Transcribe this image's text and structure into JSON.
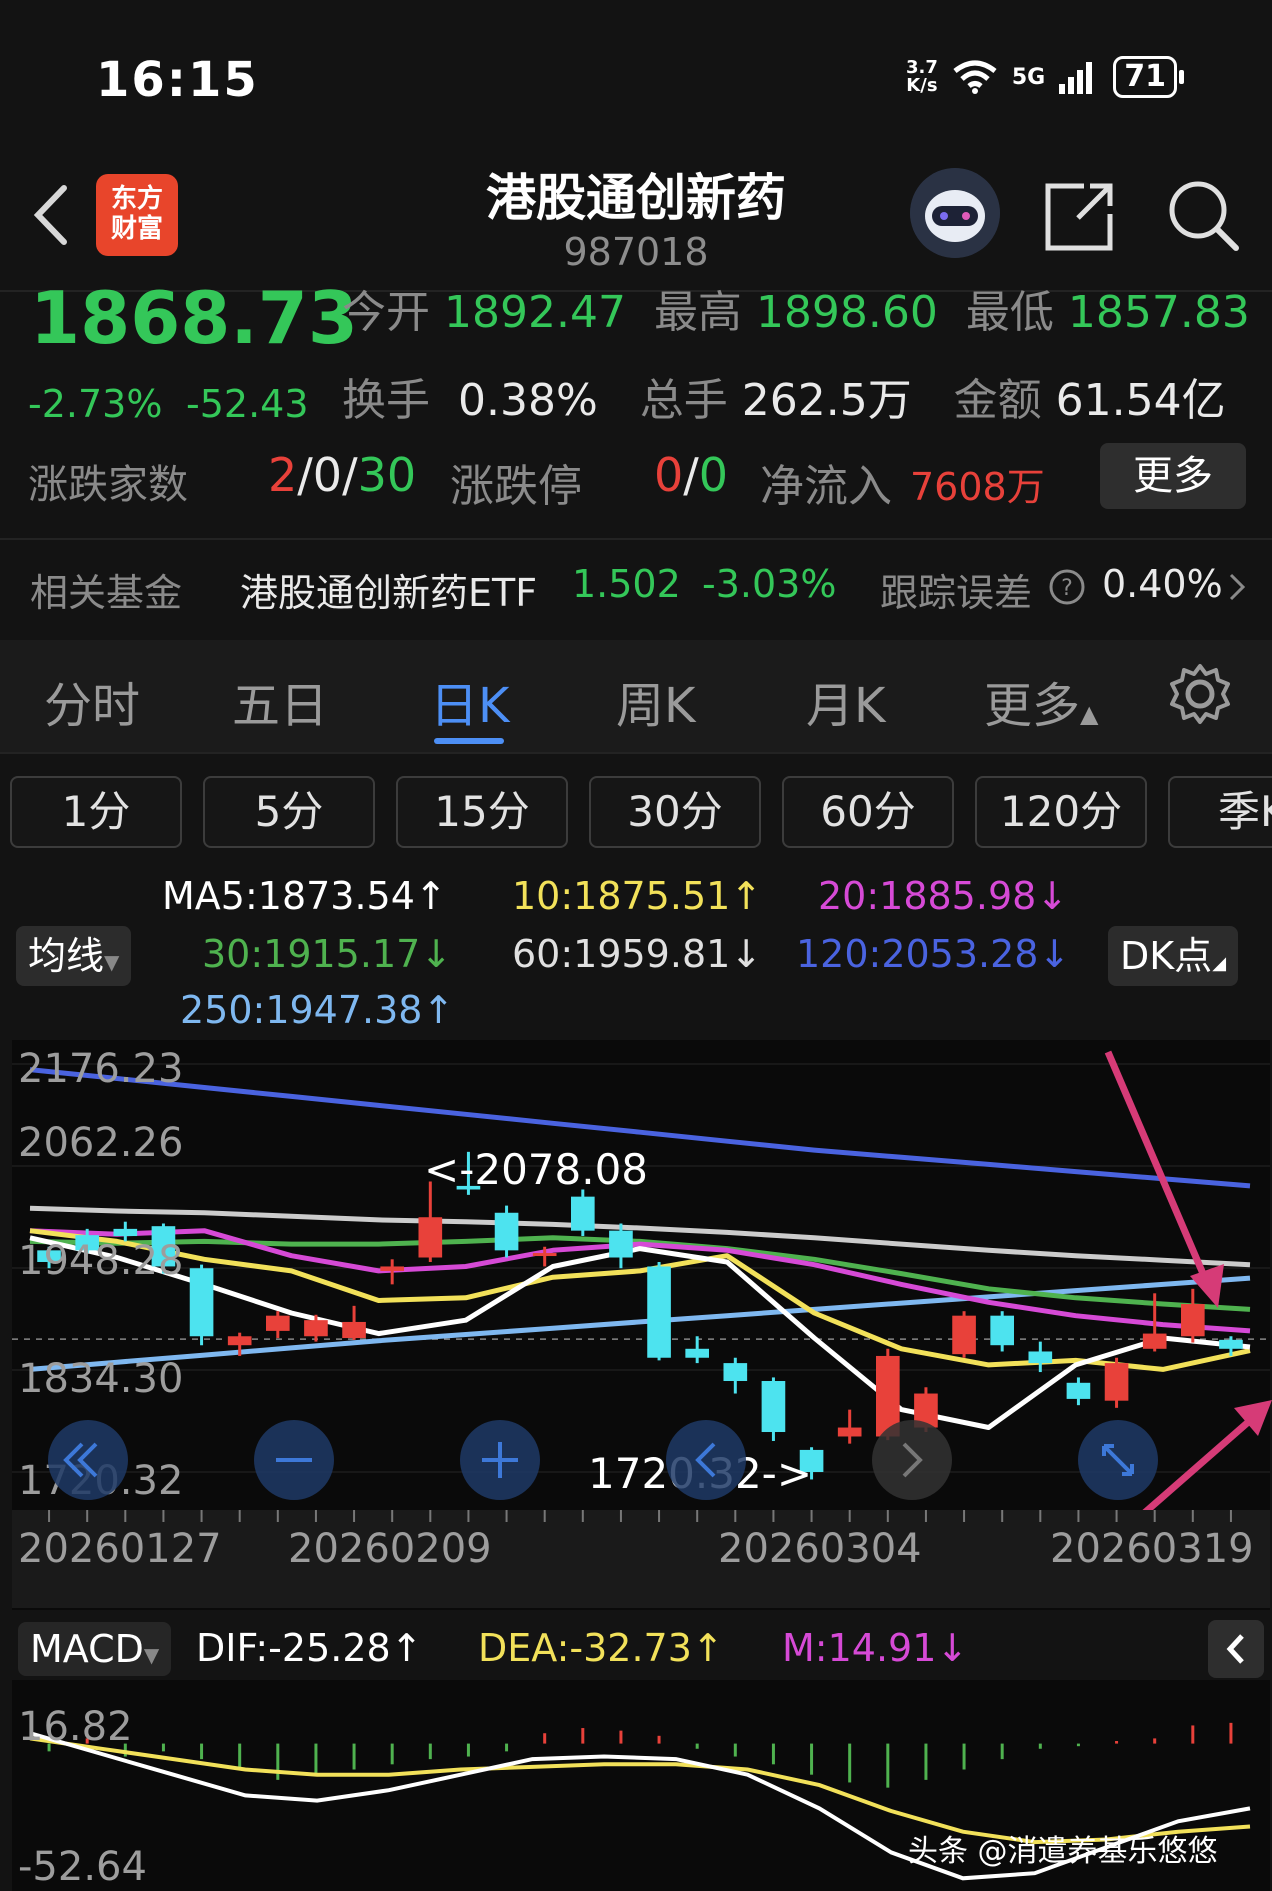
{
  "status": {
    "time": "16:15",
    "net_speed_top": "3.7",
    "net_speed_bottom": "K/s",
    "signal": "5G",
    "battery": "71"
  },
  "header": {
    "title": "港股通创新药",
    "code": "987018",
    "logo_line1": "东方",
    "logo_line2": "财富"
  },
  "quote": {
    "price": "1868.73",
    "change_pct": "-2.73%",
    "change": "-52.43",
    "open_label": "今开",
    "open": "1892.47",
    "high_label": "最高",
    "high": "1898.60",
    "low_label": "最低",
    "low": "1857.83",
    "turnover_label": "换手",
    "turnover": "0.38%",
    "volume_label": "总手",
    "volume": "262.5万",
    "amount_label": "金额",
    "amount": "61.54亿",
    "breadth_label": "涨跌家数",
    "breadth_up": "2",
    "breadth_flat": "0",
    "breadth_down": "30",
    "limit_label": "涨跌停",
    "limit_up": "0",
    "limit_down": "0",
    "netflow_label": "净流入",
    "netflow": "7608万",
    "more_label": "更多"
  },
  "fund": {
    "label": "相关基金",
    "name": "港股通创新药ETF",
    "price": "1.502",
    "pct": "-3.03%",
    "te_label": "跟踪误差",
    "te_value": "0.40%"
  },
  "tabs": [
    "分时",
    "五日",
    "日K",
    "周K",
    "月K",
    "更多"
  ],
  "active_tab": "日K",
  "periods": [
    "1分",
    "5分",
    "15分",
    "30分",
    "60分",
    "120分",
    "季K"
  ],
  "ma": {
    "ma5": "MA5:1873.54↑",
    "ma10": "10:1875.51↑",
    "ma20": "20:1885.98↓",
    "ma30": "30:1915.17↓",
    "ma60": "60:1959.81↓",
    "ma120": "120:2053.28↓",
    "ma250": "250:1947.38↑",
    "indicator_btn": "均线",
    "dk_btn": "DK点"
  },
  "colors": {
    "up": "#e8413a",
    "down": "#4de3ef",
    "ma5": "#ffffff",
    "ma10": "#f2e15a",
    "ma20": "#d64ad6",
    "ma30": "#4fb24f",
    "ma60": "#cccccc",
    "ma120": "#4a63e0",
    "ma250": "#7fb8f0",
    "accent": "#4d8ff5",
    "arrow": "#d63b77"
  },
  "chart_data": {
    "type": "candlestick",
    "y_ticks": [
      "2176.23",
      "2062.26",
      "1948.28",
      "1834.30",
      "1720.32"
    ],
    "ylim": [
      1720.32,
      2176.23
    ],
    "x_ticks": [
      "20260127",
      "20260209",
      "20260304",
      "20260319"
    ],
    "annotation_high": "<-2078.08",
    "annotation_low": "1720.32->",
    "candles": [
      {
        "o": 1968,
        "c": 1955,
        "h": 1972,
        "l": 1948
      },
      {
        "o": 1985,
        "c": 1968,
        "h": 1992,
        "l": 1965
      },
      {
        "o": 1992,
        "c": 1984,
        "h": 2000,
        "l": 1978
      },
      {
        "o": 1995,
        "c": 1950,
        "h": 1998,
        "l": 1942
      },
      {
        "o": 1948,
        "c": 1872,
        "h": 1952,
        "l": 1862
      },
      {
        "o": 1862,
        "c": 1872,
        "h": 1876,
        "l": 1850
      },
      {
        "o": 1878,
        "c": 1895,
        "h": 1900,
        "l": 1870
      },
      {
        "o": 1872,
        "c": 1890,
        "h": 1896,
        "l": 1866
      },
      {
        "o": 1870,
        "c": 1888,
        "h": 1906,
        "l": 1868
      },
      {
        "o": 1945,
        "c": 1950,
        "h": 1958,
        "l": 1930
      },
      {
        "o": 1960,
        "c": 2005,
        "h": 2045,
        "l": 1955
      },
      {
        "o": 2040,
        "c": 2036,
        "h": 2078.08,
        "l": 2030
      },
      {
        "o": 2010,
        "c": 1968,
        "h": 2018,
        "l": 1960
      },
      {
        "o": 1965,
        "c": 1965,
        "h": 1972,
        "l": 1950
      },
      {
        "o": 2028,
        "c": 1990,
        "h": 2036,
        "l": 1984
      },
      {
        "o": 1990,
        "c": 1960,
        "h": 1998,
        "l": 1948
      },
      {
        "o": 1950,
        "c": 1848,
        "h": 1955,
        "l": 1845
      },
      {
        "o": 1858,
        "c": 1848,
        "h": 1872,
        "l": 1842
      },
      {
        "o": 1842,
        "c": 1822,
        "h": 1848,
        "l": 1808
      },
      {
        "o": 1822,
        "c": 1765,
        "h": 1826,
        "l": 1755
      },
      {
        "o": 1745,
        "c": 1720.32,
        "h": 1748,
        "l": 1712
      },
      {
        "o": 1760,
        "c": 1770,
        "h": 1790,
        "l": 1752
      },
      {
        "o": 1760,
        "c": 1850,
        "h": 1858,
        "l": 1756
      },
      {
        "o": 1770,
        "c": 1808,
        "h": 1815,
        "l": 1765
      },
      {
        "o": 1852,
        "c": 1895,
        "h": 1900,
        "l": 1848
      },
      {
        "o": 1895,
        "c": 1862,
        "h": 1900,
        "l": 1855
      },
      {
        "o": 1855,
        "c": 1842,
        "h": 1866,
        "l": 1832
      },
      {
        "o": 1820,
        "c": 1802,
        "h": 1826,
        "l": 1795
      },
      {
        "o": 1800,
        "c": 1842,
        "h": 1848,
        "l": 1792
      },
      {
        "o": 1858,
        "c": 1875,
        "h": 1920,
        "l": 1855
      },
      {
        "o": 1872,
        "c": 1908,
        "h": 1925,
        "l": 1865
      },
      {
        "o": 1868,
        "c": 1858,
        "h": 1872,
        "l": 1850
      }
    ],
    "ma_series": [
      {
        "key": "ma120",
        "values": [
          2170,
          2160,
          2150,
          2140,
          2130,
          2120,
          2110,
          2100,
          2090,
          2080,
          2072,
          2064,
          2056,
          2048,
          2040
        ]
      },
      {
        "key": "ma250",
        "values": [
          1835,
          1843,
          1851,
          1859,
          1867,
          1874,
          1881,
          1888,
          1895,
          1902,
          1909,
          1916,
          1923,
          1930,
          1937
        ]
      },
      {
        "key": "ma60",
        "values": [
          2015,
          2012,
          2010,
          2006,
          2002,
          2000,
          1997,
          1993,
          1988,
          1982,
          1975,
          1968,
          1962,
          1957,
          1952
        ]
      },
      {
        "key": "ma30",
        "values": [
          1978,
          1976,
          1978,
          1975,
          1975,
          1978,
          1982,
          1978,
          1970,
          1958,
          1942,
          1925,
          1915,
          1908,
          1902
        ]
      },
      {
        "key": "ma20",
        "values": [
          1990,
          1986,
          1990,
          1962,
          1945,
          1950,
          1968,
          1975,
          1968,
          1952,
          1930,
          1910,
          1895,
          1885,
          1878
        ]
      },
      {
        "key": "ma10",
        "values": [
          1990,
          1978,
          1958,
          1945,
          1912,
          1915,
          1938,
          1945,
          1962,
          1898,
          1858,
          1840,
          1845,
          1835,
          1856
        ]
      },
      {
        "key": "ma5",
        "values": [
          1982,
          1960,
          1930,
          1898,
          1875,
          1890,
          1950,
          1970,
          1955,
          1870,
          1790,
          1770,
          1840,
          1870,
          1860
        ]
      }
    ]
  },
  "macd": {
    "label": "MACD",
    "dif": "DIF:-25.28↑",
    "dea": "DEA:-32.73↑",
    "m": "M:14.91↓",
    "y_top": "16.82",
    "y_bottom": "-52.64",
    "bars": [
      -3,
      2,
      -5,
      -3,
      -6,
      -10,
      -14,
      -12,
      -10,
      -8,
      -6,
      -5,
      -3,
      4,
      6,
      5,
      3,
      -2,
      -5,
      -8,
      -12,
      -15,
      -17,
      -14,
      -10,
      -6,
      -2,
      -1,
      1,
      2,
      7,
      8
    ],
    "dif_line": [
      4,
      -4,
      -12,
      -20,
      -22,
      -18,
      -12,
      -6,
      -5,
      -6,
      -12,
      -25,
      -42,
      -52,
      -50,
      -40,
      -30,
      -25
    ],
    "dea_line": [
      2,
      -2,
      -6,
      -10,
      -12,
      -12,
      -10,
      -9,
      -8,
      -8,
      -10,
      -16,
      -26,
      -34,
      -38,
      -37,
      -34,
      -32
    ]
  },
  "watermark": "头条 @消遣养基乐悠悠"
}
